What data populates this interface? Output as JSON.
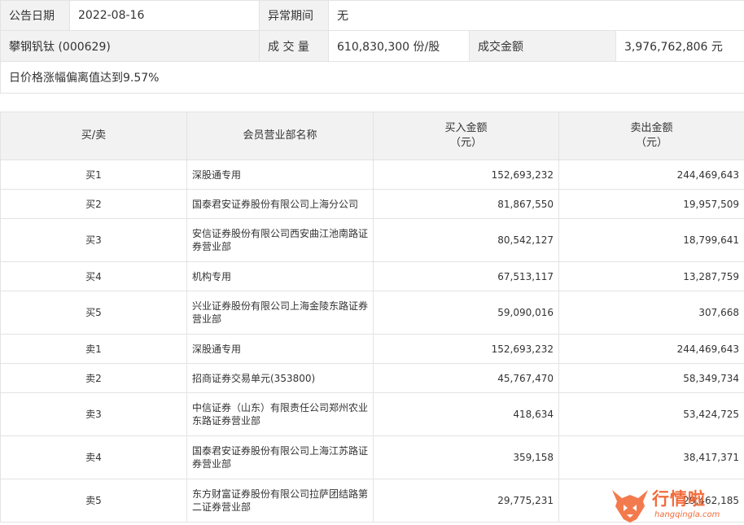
{
  "info": {
    "announce_date_label": "公告日期",
    "announce_date": "2022-08-16",
    "abnormal_period_label": "异常期间",
    "abnormal_period": "无",
    "stock": "攀钢钒钛 (000629)",
    "volume_label": "成 交 量",
    "volume": "610,830,300 份/股",
    "turnover_label": "成交金额",
    "turnover": "3,976,762,806 元",
    "note": "日价格涨幅偏离值达到9.57%"
  },
  "headers": {
    "type": "买/卖",
    "name": "会员营业部名称",
    "buy": "买入金额",
    "buy_unit": "（元）",
    "sell": "卖出金额",
    "sell_unit": "（元）"
  },
  "rows": [
    {
      "type": "买1",
      "name": "深股通专用",
      "buy": "152,693,232",
      "sell": "244,469,643"
    },
    {
      "type": "买2",
      "name": "国泰君安证券股份有限公司上海分公司",
      "buy": "81,867,550",
      "sell": "19,957,509"
    },
    {
      "type": "买3",
      "name": "安信证券股份有限公司西安曲江池南路证券营业部",
      "buy": "80,542,127",
      "sell": "18,799,641"
    },
    {
      "type": "买4",
      "name": "机构专用",
      "buy": "67,513,117",
      "sell": "13,287,759"
    },
    {
      "type": "买5",
      "name": "兴业证券股份有限公司上海金陵东路证券营业部",
      "buy": "59,090,016",
      "sell": "307,668"
    },
    {
      "type": "卖1",
      "name": "深股通专用",
      "buy": "152,693,232",
      "sell": "244,469,643"
    },
    {
      "type": "卖2",
      "name": "招商证券交易单元(353800)",
      "buy": "45,767,470",
      "sell": "58,349,734"
    },
    {
      "type": "卖3",
      "name": "中信证券（山东）有限责任公司郑州农业东路证券营业部",
      "buy": "418,634",
      "sell": "53,424,725"
    },
    {
      "type": "卖4",
      "name": "国泰君安证券股份有限公司上海江苏路证券营业部",
      "buy": "359,158",
      "sell": "38,417,371"
    },
    {
      "type": "卖5",
      "name": "东方财富证券股份有限公司拉萨团结路第二证券营业部",
      "buy": "29,775,231",
      "sell": "29,462,185"
    }
  ],
  "watermark": {
    "icon": "bull-logo-icon",
    "text": "行情啦",
    "url": "hangqingla.com",
    "color": "#f26b3a"
  }
}
